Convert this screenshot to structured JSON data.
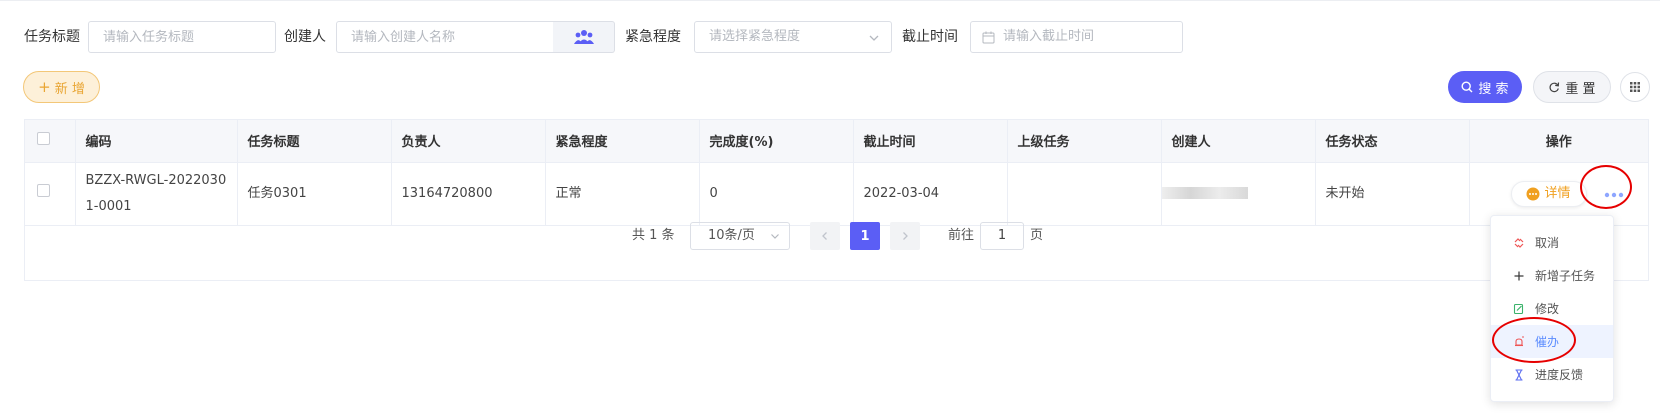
{
  "filters": {
    "title_label": "任务标题",
    "title_placeholder": "请输入任务标题",
    "creator_label": "创建人",
    "creator_placeholder": "请输入创建人名称",
    "urgency_label": "紧急程度",
    "urgency_placeholder": "请选择紧急程度",
    "deadline_label": "截止时间",
    "deadline_placeholder": "请输入截止时间"
  },
  "toolbar": {
    "add_label": "新 增",
    "search_label": "搜 索",
    "reset_label": "重 置"
  },
  "table": {
    "columns": [
      "编码",
      "任务标题",
      "负责人",
      "紧急程度",
      "完成度(%)",
      "截止时间",
      "上级任务",
      "创建人",
      "任务状态",
      "操作"
    ],
    "rows": [
      {
        "code": "BZZX-RWGL-20220301-0001",
        "title": "任务0301",
        "owner": "13164720800",
        "urgency": "正常",
        "progress": "0",
        "deadline": "2022-03-04",
        "parent": "",
        "creator": "",
        "status": "未开始",
        "detail_label": "详情"
      }
    ]
  },
  "pagination": {
    "total": "共 1 条",
    "page_size": "10条/页",
    "current": "1",
    "goto_label": "前往",
    "goto_value": "1",
    "page_suffix": "页"
  },
  "menu": {
    "items": [
      "取消",
      "新增子任务",
      "修改",
      "催办",
      "进度反馈"
    ],
    "hovered": "催办"
  },
  "colors": {
    "primary": "#5b5ef5",
    "add_button_text": "#e9a533",
    "highlight_circle": "#e60000"
  }
}
